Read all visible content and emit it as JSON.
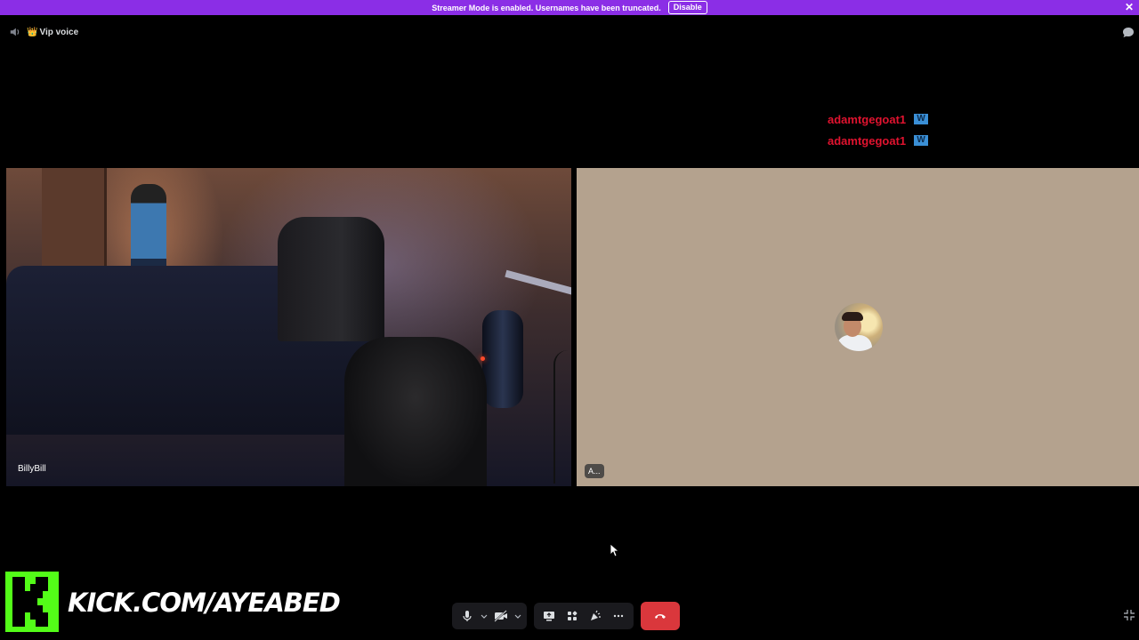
{
  "banner": {
    "text": "Streamer Mode is enabled. Usernames have been truncated.",
    "button": "Disable",
    "close": "✕"
  },
  "channel": {
    "name": "Vip voice",
    "emoji": "👑"
  },
  "chat": {
    "messages": [
      {
        "user": "adamtgegoat1",
        "badge": "W"
      },
      {
        "user": "adamtgegoat1",
        "badge": "W"
      }
    ]
  },
  "participants": [
    {
      "name": "BillyBill"
    },
    {
      "name": "A..."
    }
  ],
  "overlay": {
    "kick_url": "KICK.COM/AYEABED"
  },
  "colors": {
    "banner": "#8b2ee6",
    "hangup": "#da373c",
    "kick_green": "#53fc18",
    "chat_name": "#e0132f"
  }
}
